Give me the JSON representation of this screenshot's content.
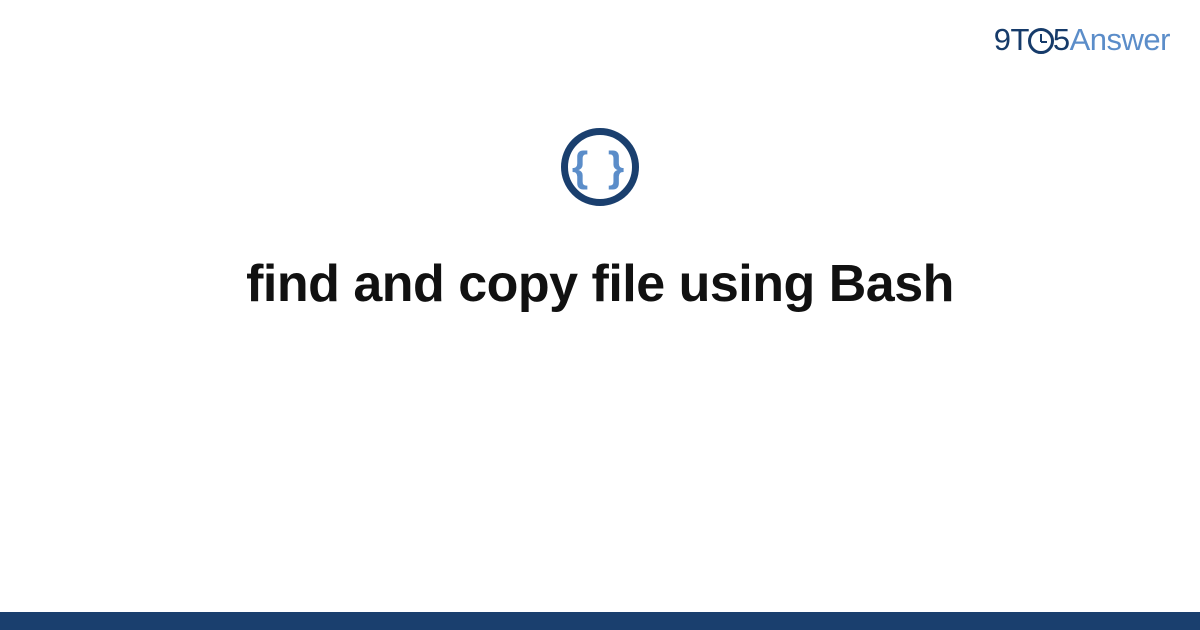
{
  "logo": {
    "nine": "9",
    "t": "T",
    "five": "5",
    "answer": "Answer"
  },
  "icon": {
    "glyph": "{ }"
  },
  "title": "find and copy file using Bash",
  "colors": {
    "brand_dark": "#1a3f6e",
    "brand_light": "#5b8dc9",
    "text": "#111111",
    "background": "#ffffff"
  }
}
